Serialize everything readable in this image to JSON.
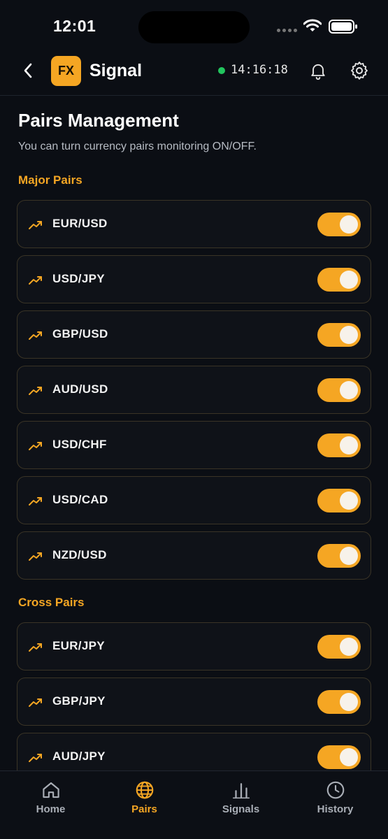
{
  "status_bar": {
    "time": "12:01"
  },
  "header": {
    "back_icon": "chevron-left-icon",
    "logo_text": "FX",
    "title": "Signal",
    "live_status_color": "#22c55e",
    "clock": "14:16:18",
    "notification_icon": "bell-icon",
    "settings_icon": "gear-icon"
  },
  "page": {
    "title": "Pairs Management",
    "subtitle": "You can turn currency pairs monitoring ON/OFF."
  },
  "sections": [
    {
      "title": "Major Pairs",
      "pairs": [
        {
          "label": "EUR/USD",
          "enabled": true
        },
        {
          "label": "USD/JPY",
          "enabled": true
        },
        {
          "label": "GBP/USD",
          "enabled": true
        },
        {
          "label": "AUD/USD",
          "enabled": true
        },
        {
          "label": "USD/CHF",
          "enabled": true
        },
        {
          "label": "USD/CAD",
          "enabled": true
        },
        {
          "label": "NZD/USD",
          "enabled": true
        }
      ]
    },
    {
      "title": "Cross Pairs",
      "pairs": [
        {
          "label": "EUR/JPY",
          "enabled": true
        },
        {
          "label": "GBP/JPY",
          "enabled": true
        },
        {
          "label": "AUD/JPY",
          "enabled": true
        }
      ]
    }
  ],
  "nav": {
    "items": [
      {
        "label": "Home",
        "icon": "home-icon",
        "active": false
      },
      {
        "label": "Pairs",
        "icon": "globe-icon",
        "active": true
      },
      {
        "label": "Signals",
        "icon": "bar-chart-icon",
        "active": false
      },
      {
        "label": "History",
        "icon": "clock-icon",
        "active": false
      }
    ]
  },
  "colors": {
    "accent": "#f5a623",
    "background": "#0b0e14",
    "card_border": "#3a3426",
    "live": "#22c55e"
  }
}
